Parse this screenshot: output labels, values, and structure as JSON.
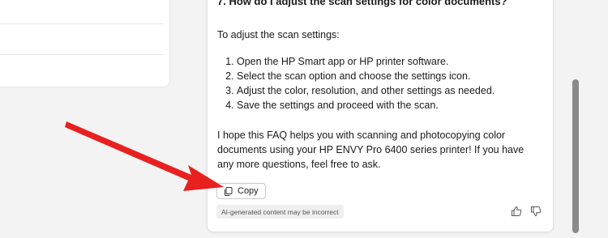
{
  "chat": {
    "question": "7. How do I adjust the scan settings for color documents?",
    "intro": "To adjust the scan settings:",
    "steps": [
      "Open the HP Smart app or HP printer software.",
      "Select the scan option and choose the settings icon.",
      "Adjust the color, resolution, and other settings as needed.",
      "Save the settings and proceed with the scan."
    ],
    "closing": "I hope this FAQ helps you with scanning and photocopying color documents using your HP ENVY Pro 6400 series printer! If you have any more questions, feel free to ask.",
    "copy_label": "Copy",
    "disclaimer": "AI-generated content may be incorrect"
  },
  "icons": {
    "copy": "copy-icon",
    "thumbs_up": "thumbs-up-icon",
    "thumbs_down": "thumbs-down-icon"
  },
  "colors": {
    "annotation_arrow": "#e8201f",
    "scroll_thumb": "#8a8a8a"
  }
}
